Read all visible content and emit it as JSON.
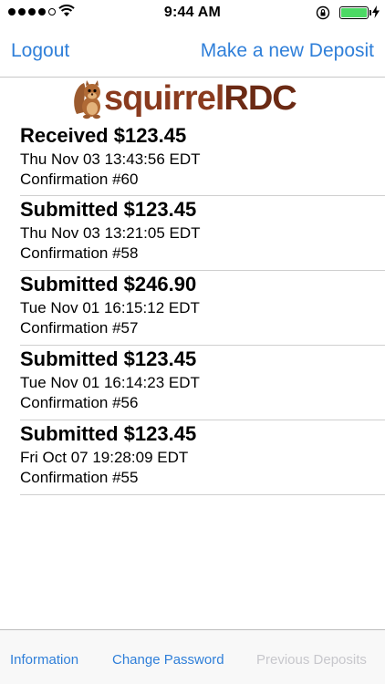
{
  "status_bar": {
    "time": "9:44 AM",
    "icons": [
      "signal-dots-icon",
      "wifi-icon",
      "rotation-lock-icon",
      "battery-icon",
      "charging-bolt-icon"
    ],
    "battery_color": "#4cd964"
  },
  "nav": {
    "left_label": "Logout",
    "right_label": "Make a new Deposit",
    "accent_color": "#2f7fd9"
  },
  "logo": {
    "part1": "squirrel",
    "part2": "RDC",
    "color_part1": "#8a3b1f",
    "color_part2": "#6b2a14"
  },
  "deposits": [
    {
      "title": "Received $123.45",
      "date": "Thu Nov 03 13:43:56 EDT",
      "confirmation": "Confirmation #60"
    },
    {
      "title": "Submitted $123.45",
      "date": "Thu Nov 03 13:21:05 EDT",
      "confirmation": "Confirmation #58"
    },
    {
      "title": "Submitted $246.90",
      "date": "Tue Nov 01 16:15:12 EDT",
      "confirmation": "Confirmation #57"
    },
    {
      "title": "Submitted $123.45",
      "date": "Tue Nov 01 16:14:23 EDT",
      "confirmation": "Confirmation #56"
    },
    {
      "title": "Submitted $123.45",
      "date": "Fri Oct 07 19:28:09 EDT",
      "confirmation": "Confirmation #55"
    }
  ],
  "tabs": [
    {
      "label": "Information",
      "state": "enabled"
    },
    {
      "label": "Change Password",
      "state": "enabled"
    },
    {
      "label": "Previous Deposits",
      "state": "selected"
    }
  ]
}
